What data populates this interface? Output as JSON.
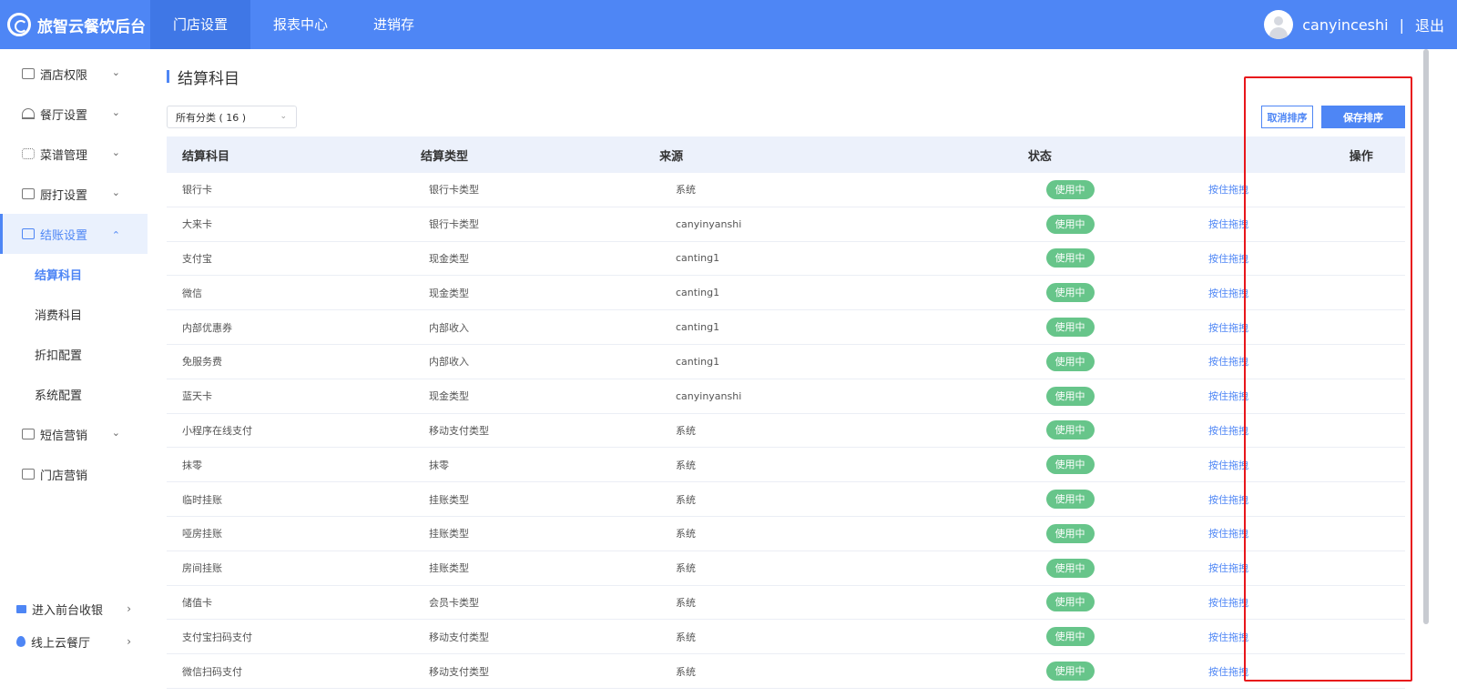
{
  "brand": {
    "name": "旅智云餐饮后台"
  },
  "topnav": [
    {
      "label": "门店设置",
      "active": true
    },
    {
      "label": "报表中心",
      "active": false
    },
    {
      "label": "进销存",
      "active": false
    }
  ],
  "user": {
    "name": "canyinceshi",
    "separator": "|",
    "logout": "退出"
  },
  "sidebar": {
    "items": [
      {
        "label": "酒店权限",
        "icon": "building-icon",
        "chevron": "⌄"
      },
      {
        "label": "餐厅设置",
        "icon": "cloche-icon",
        "chevron": "⌄"
      },
      {
        "label": "菜谱管理",
        "icon": "grid-icon",
        "chevron": "⌄"
      },
      {
        "label": "厨打设置",
        "icon": "printer-icon",
        "chevron": "⌄"
      },
      {
        "label": "结账设置",
        "icon": "receipt-icon",
        "chevron": "⌃"
      }
    ],
    "subitems": [
      {
        "label": "结算科目",
        "active": true
      },
      {
        "label": "消费科目",
        "active": false
      },
      {
        "label": "折扣配置",
        "active": false
      },
      {
        "label": "系统配置",
        "active": false
      }
    ],
    "after": [
      {
        "label": "短信营销",
        "icon": "mail-icon",
        "chevron": "⌄"
      },
      {
        "label": "门店营销",
        "icon": "store-icon",
        "chevron": ""
      }
    ],
    "bottom": [
      {
        "label": "进入前台收银",
        "icon": "monitor-icon",
        "chevron": "›"
      },
      {
        "label": "线上云餐厅",
        "icon": "location-pin-icon",
        "chevron": "›"
      }
    ]
  },
  "page": {
    "title": "结算科目",
    "filter": "所有分类 ( 16 )",
    "cancel_sort": "取消排序",
    "save_sort": "保存排序"
  },
  "table": {
    "headers": [
      "结算科目",
      "结算类型",
      "来源",
      "状态",
      "操作"
    ],
    "rows": [
      [
        "银行卡",
        "银行卡类型",
        "系统",
        "使用中",
        "按住拖拽"
      ],
      [
        "大来卡",
        "银行卡类型",
        "canyinyanshi",
        "使用中",
        "按住拖拽"
      ],
      [
        "支付宝",
        "现金类型",
        "canting1",
        "使用中",
        "按住拖拽"
      ],
      [
        "微信",
        "现金类型",
        "canting1",
        "使用中",
        "按住拖拽"
      ],
      [
        "内部优惠券",
        "内部收入",
        "canting1",
        "使用中",
        "按住拖拽"
      ],
      [
        "免服务费",
        "内部收入",
        "canting1",
        "使用中",
        "按住拖拽"
      ],
      [
        "蓝天卡",
        "现金类型",
        "canyinyanshi",
        "使用中",
        "按住拖拽"
      ],
      [
        "小程序在线支付",
        "移动支付类型",
        "系统",
        "使用中",
        "按住拖拽"
      ],
      [
        "抹零",
        "抹零",
        "系统",
        "使用中",
        "按住拖拽"
      ],
      [
        "临时挂账",
        "挂账类型",
        "系统",
        "使用中",
        "按住拖拽"
      ],
      [
        "哑房挂账",
        "挂账类型",
        "系统",
        "使用中",
        "按住拖拽"
      ],
      [
        "房间挂账",
        "挂账类型",
        "系统",
        "使用中",
        "按住拖拽"
      ],
      [
        "储值卡",
        "会员卡类型",
        "系统",
        "使用中",
        "按住拖拽"
      ],
      [
        "支付宝扫码支付",
        "移动支付类型",
        "系统",
        "使用中",
        "按住拖拽"
      ],
      [
        "微信扫码支付",
        "移动支付类型",
        "系统",
        "使用中",
        "按住拖拽"
      ]
    ]
  },
  "colors": {
    "primary": "#4e86f5",
    "status": "#67c58a",
    "highlight": "#e8161b"
  }
}
